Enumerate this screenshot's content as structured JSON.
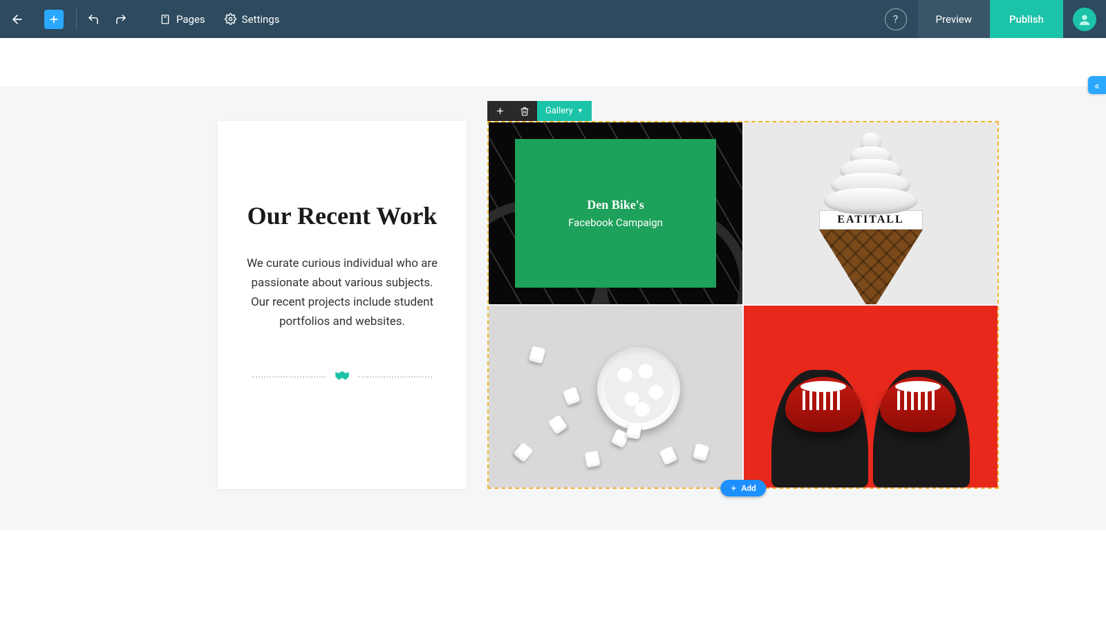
{
  "toolbar": {
    "pages_label": "Pages",
    "settings_label": "Settings",
    "preview_label": "Preview",
    "publish_label": "Publish"
  },
  "side_panel": {
    "collapse_glyph": "«"
  },
  "element_toolbar": {
    "type_label": "Gallery"
  },
  "info_card": {
    "title": "Our Recent Work",
    "body": "We curate curious individual who are passionate about various subjects. Our recent projects include student portfolios and websites."
  },
  "gallery": {
    "items": [
      {
        "overlay_title": "Den Bike's",
        "overlay_subtitle": "Facebook Campaign"
      },
      {
        "band_text": "EATITALL"
      },
      {},
      {}
    ],
    "add_label": "Add"
  }
}
